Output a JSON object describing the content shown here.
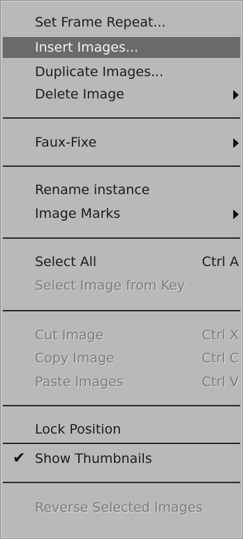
{
  "menu": {
    "items": {
      "set_frame_repeat": {
        "label": "Set Frame Repeat..."
      },
      "insert_images": {
        "label": "Insert Images..."
      },
      "duplicate_images": {
        "label": "Duplicate Images..."
      },
      "delete_image": {
        "label": "Delete Image"
      },
      "faux_fixe": {
        "label": "Faux-Fixe"
      },
      "rename_instance": {
        "label": "Rename instance"
      },
      "image_marks": {
        "label": "Image Marks"
      },
      "select_all": {
        "label": "Select All",
        "shortcut": "Ctrl A"
      },
      "select_image_from_key": {
        "label": "Select Image from Key"
      },
      "cut_image": {
        "label": "Cut Image",
        "shortcut": "Ctrl X"
      },
      "copy_image": {
        "label": "Copy Image",
        "shortcut": "Ctrl C"
      },
      "paste_images": {
        "label": "Paste Images",
        "shortcut": "Ctrl V"
      },
      "lock_position": {
        "label": "Lock Position"
      },
      "show_thumbnails": {
        "label": "Show Thumbnails",
        "checked": true
      },
      "reverse_selected_images": {
        "label": "Reverse Selected Images"
      }
    },
    "icons": {
      "submenu": "submenu-arrow-icon",
      "check": "checkmark-icon"
    },
    "colors": {
      "background": "#b9b9b9",
      "highlight": "#6a6a6a",
      "disabled_text": "#7c7c7c",
      "separator": "#2a2a2a"
    }
  }
}
